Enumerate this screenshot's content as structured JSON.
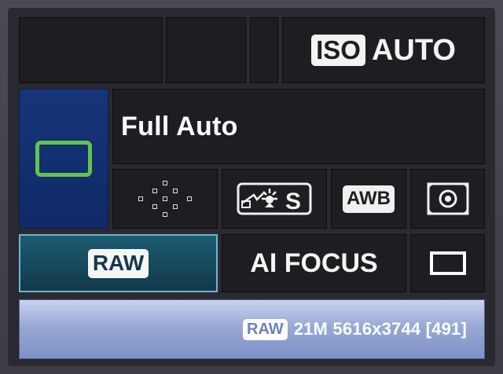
{
  "iso": {
    "label": "ISO",
    "value": "AUTO"
  },
  "shooting_mode": {
    "name": "Full Auto",
    "icon": "mode-rectangle-icon",
    "accent_color": "#66c24a"
  },
  "settings": {
    "af_points_icon": "af-points-grid-icon",
    "picture_style_icon": "picture-style-icon",
    "picture_style_label": "S",
    "white_balance": "AWB",
    "metering_icon": "evaluative-metering-icon"
  },
  "quality": {
    "label": "RAW"
  },
  "af_mode": "AI FOCUS",
  "drive_icon": "single-shot-drive-icon",
  "info_bar": {
    "badge": "RAW",
    "text": "21M 5616x3744 [491]"
  },
  "colors": {
    "mode_bg": "#16357a",
    "quality_bg": "#1d5c72",
    "info_bg": "#98a9d5"
  }
}
